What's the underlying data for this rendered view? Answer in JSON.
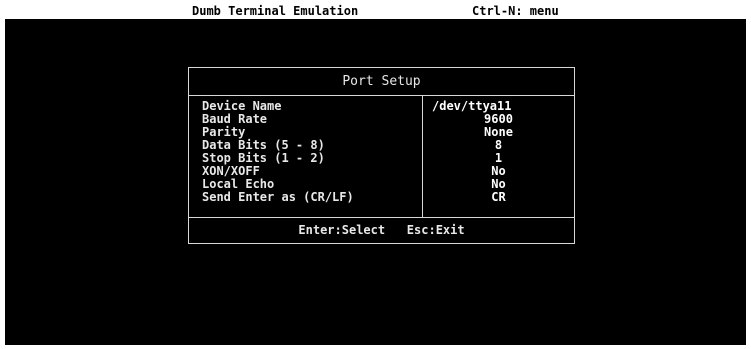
{
  "status_bar": {
    "title": "Dumb Terminal Emulation",
    "hint": "Ctrl-N: menu"
  },
  "dialog": {
    "title": "Port Setup",
    "fields": [
      {
        "label": "Device Name",
        "value": "/dev/ttya11"
      },
      {
        "label": "Baud Rate",
        "value": "9600"
      },
      {
        "label": "Parity",
        "value": "None"
      },
      {
        "label": "Data Bits (5 - 8)",
        "value": "8"
      },
      {
        "label": "Stop Bits (1 - 2)",
        "value": "1"
      },
      {
        "label": "XON/XOFF",
        "value": "No"
      },
      {
        "label": "Local Echo",
        "value": "No"
      },
      {
        "label": "Send Enter as (CR/LF)",
        "value": "CR"
      }
    ],
    "footer": {
      "select_hint": "Enter:Select",
      "exit_hint": "Esc:Exit"
    }
  }
}
